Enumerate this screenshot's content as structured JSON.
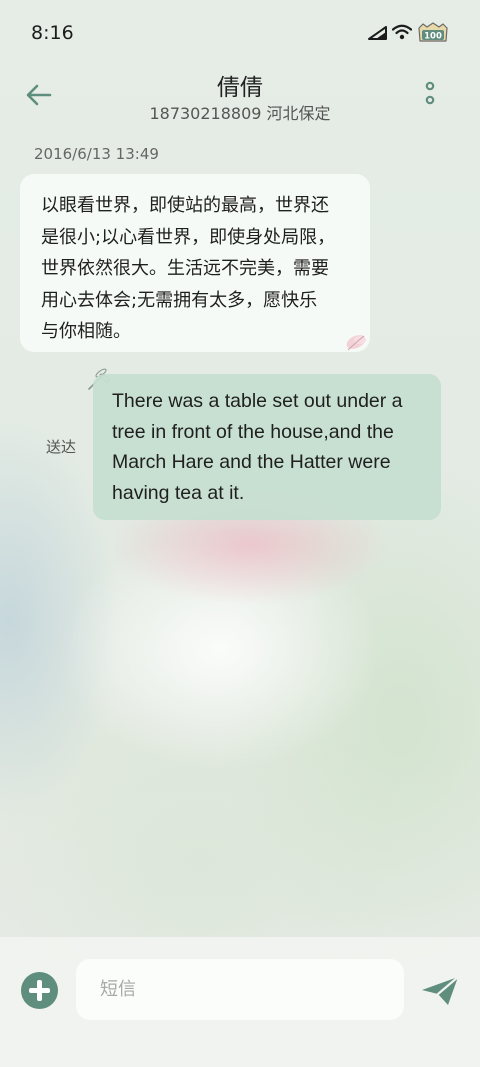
{
  "status_bar": {
    "time": "8:16",
    "battery_level": "100",
    "icons": [
      "signal-icon",
      "wifi-icon",
      "battery-icon"
    ]
  },
  "header": {
    "contact_name": "倩倩",
    "contact_subtitle": "18730218809 河北保定",
    "icons": [
      "back-arrow-icon",
      "more-options-icon"
    ]
  },
  "conversation": {
    "timestamp": "2016/6/13 13:49",
    "received_message": {
      "lines": [
        "以眼看世界，即使站的最高，世界还",
        "是很小;以心看世界，即使身处局限，",
        "世界依然很大。生活远不完美，需要",
        "用心去体会;无需拥有太多，愿快乐",
        "与你相随。"
      ]
    },
    "sent_message": {
      "lines": [
        "There was a table set out under a",
        "tree in front of the house,and the",
        "March Hare and the Hatter were",
        "having tea at it."
      ],
      "status": "送达"
    }
  },
  "composer": {
    "placeholder": "短信",
    "value": "",
    "icons": [
      "add-icon",
      "send-icon"
    ]
  },
  "colors": {
    "accent": "#5f8d7e",
    "sent_bubble": "#c6ded0",
    "received_bubble": "#f7faf7"
  }
}
